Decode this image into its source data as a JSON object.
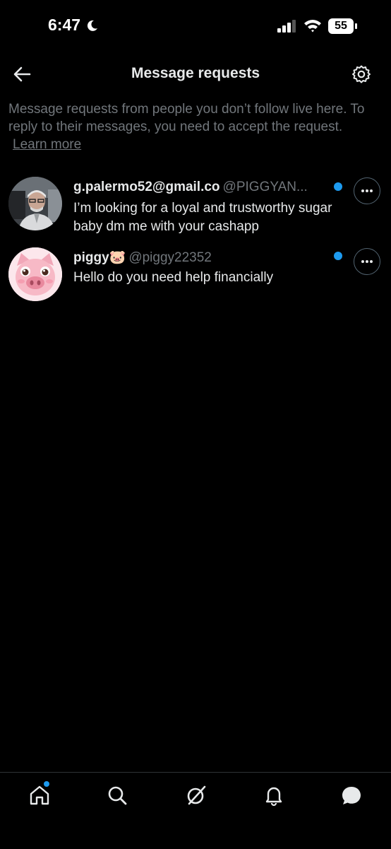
{
  "status_bar": {
    "time": "6:47",
    "battery": "55"
  },
  "header": {
    "title": "Message requests"
  },
  "info": {
    "text": "Message requests from people you don’t follow live here. To reply to their messages, you need to accept the request.",
    "link": "Learn more"
  },
  "requests": [
    {
      "name": "g.palermo52@gmail.co",
      "handle": "@PIGGYAN...",
      "message": "I’m looking for a loyal and trustworthy sugar baby dm me with your cashapp",
      "unread": true
    },
    {
      "name": "piggy🐷",
      "handle": "@piggy22352",
      "message": "Hello do you need help financially",
      "unread": true
    }
  ],
  "colors": {
    "accent": "#1d9bf0",
    "background": "#000000",
    "muted": "#71767b"
  },
  "nav": [
    "home-icon",
    "search-icon",
    "grok-icon",
    "notifications-icon",
    "messages-icon"
  ]
}
